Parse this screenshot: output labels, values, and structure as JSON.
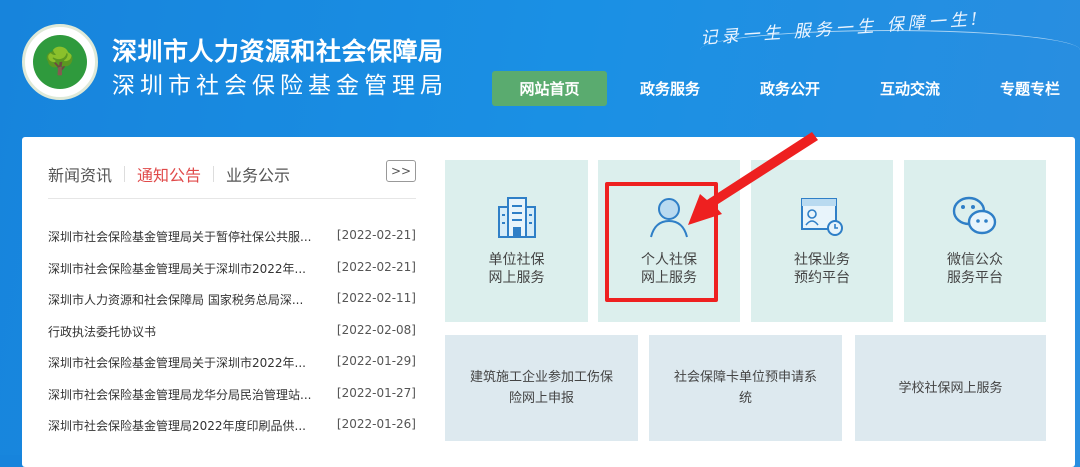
{
  "header": {
    "org_name": "深圳市人力资源和社会保障局",
    "sub_name": "深圳市社会保险基金管理局",
    "slogan": "记录一生 服务一生 保障一生!",
    "logo_text": "深圳市人力资源和社会保障局"
  },
  "nav": [
    {
      "label": "网站首页",
      "active": true
    },
    {
      "label": "政务服务"
    },
    {
      "label": "政务公开"
    },
    {
      "label": "互动交流"
    },
    {
      "label": "专题专栏"
    }
  ],
  "news": {
    "tabs": [
      "新闻资讯",
      "通知公告",
      "业务公示"
    ],
    "active_tab": "通知公告",
    "more_label": ">>",
    "items": [
      {
        "title": "深圳市社会保险基金管理局关于暂停社保公共服...",
        "date": "[2022-02-21]"
      },
      {
        "title": "深圳市社会保险基金管理局关于深圳市2022年...",
        "date": "[2022-02-21]"
      },
      {
        "title": "深圳市人力资源和社会保障局 国家税务总局深...",
        "date": "[2022-02-11]"
      },
      {
        "title": "行政执法委托协议书",
        "date": "[2022-02-08]"
      },
      {
        "title": "深圳市社会保险基金管理局关于深圳市2022年...",
        "date": "[2022-01-29]"
      },
      {
        "title": "深圳市社会保险基金管理局龙华分局民治管理站...",
        "date": "[2022-01-27]"
      },
      {
        "title": "深圳市社会保险基金管理局2022年度印刷品供...",
        "date": "[2022-01-26]"
      }
    ]
  },
  "services": [
    {
      "l1": "单位社保",
      "l2": "网上服务",
      "icon": "building-icon"
    },
    {
      "l1": "个人社保",
      "l2": "网上服务",
      "icon": "person-icon",
      "highlighted": true
    },
    {
      "l1": "社保业务",
      "l2": "预约平台",
      "icon": "appointment-icon"
    },
    {
      "l1": "微信公众",
      "l2": "服务平台",
      "icon": "wechat-icon"
    }
  ],
  "services2": [
    {
      "label": "建筑施工企业参加工伤保险网上申报"
    },
    {
      "label": "社会保障卡单位预申请系统"
    },
    {
      "label": "学校社保网上服务"
    }
  ],
  "colors": {
    "accent": "#5aab6f",
    "active_tab": "#e04a4a",
    "highlight": "#ee2020"
  }
}
